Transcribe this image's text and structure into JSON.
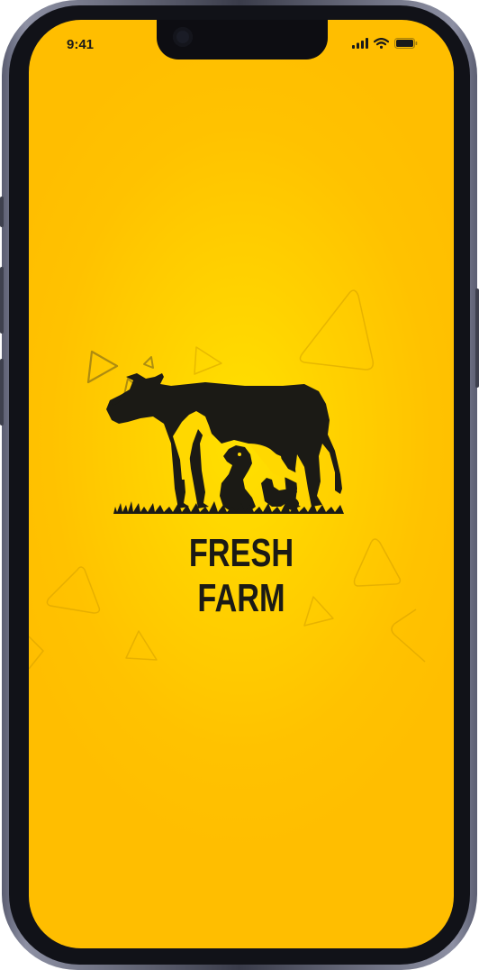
{
  "status_bar": {
    "time": "9:41",
    "signal_icon": "cellular-signal-icon",
    "wifi_icon": "wifi-icon",
    "battery_icon": "battery-icon"
  },
  "splash": {
    "brand_name": "FRESH FARM",
    "logo_icon": "farm-animals-logo"
  },
  "colors": {
    "background_center": "#ffe100",
    "background_edge": "#ffbe00",
    "logo": "#1b1a15"
  }
}
